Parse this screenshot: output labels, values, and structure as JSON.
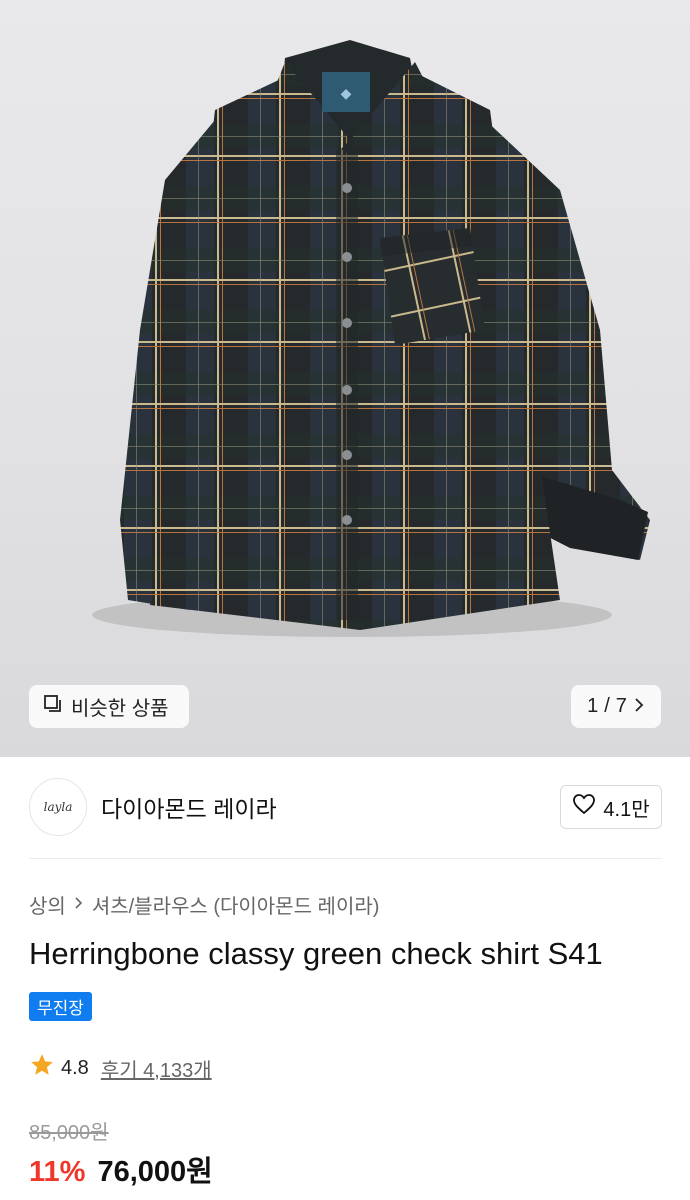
{
  "gallery": {
    "similar_label": "비슷한 상품",
    "page_current": "1",
    "page_separator": "/",
    "page_total": "7",
    "shirt_colors": {
      "base": "#25292b",
      "navy": "#2c3a4d",
      "green": "#23312c",
      "stripe_light": "#c9b98d",
      "stripe_orange": "#b8743e"
    }
  },
  "brand": {
    "logo_text": "layla",
    "name": "다이아몬드 레이라",
    "likes": "4.1만"
  },
  "breadcrumb": {
    "category": "상의",
    "subcategory": "셔츠/블라우스 (다이아몬드 레이라)"
  },
  "product": {
    "title": "Herringbone classy green check shirt S41",
    "badge": "무진장",
    "badge_color": "#0f7df0",
    "rating": "4.8",
    "reviews": "후기 4,133개",
    "original_price": "85,000원",
    "discount": "11%",
    "sale_price": "76,000원",
    "discount_color": "#f0362b"
  }
}
